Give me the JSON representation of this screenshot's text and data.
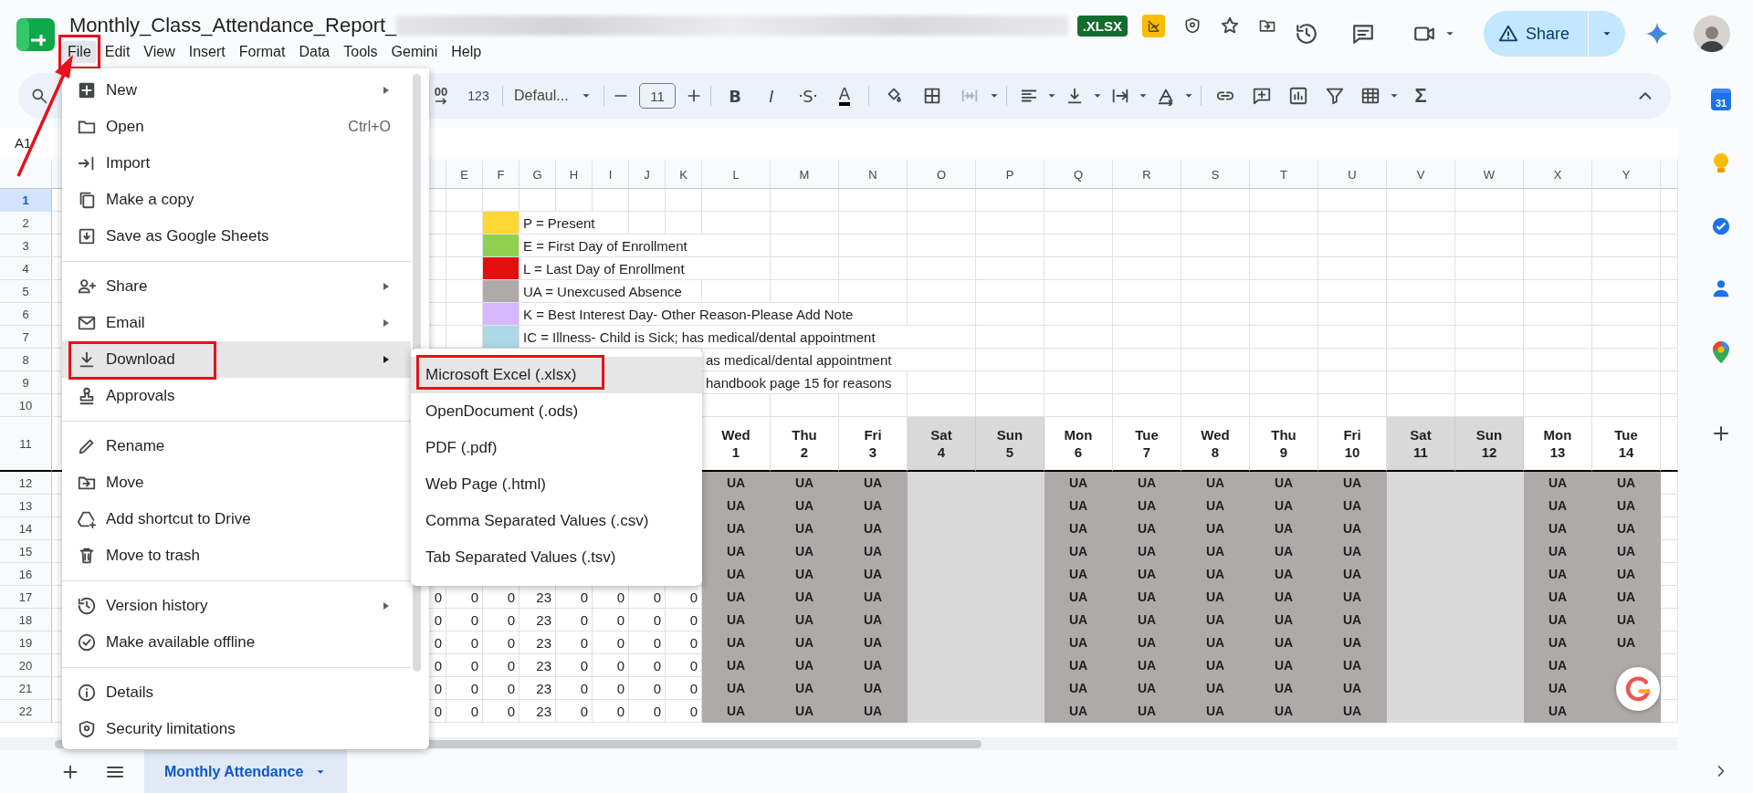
{
  "document": {
    "title": "Monthly_Class_Attendance_Report_",
    "format_badge": ".XLSX"
  },
  "menu_bar": [
    {
      "label": "File",
      "selected": true,
      "annotated": true
    },
    {
      "label": "Edit",
      "selected": false,
      "annotated": false
    },
    {
      "label": "View",
      "selected": false,
      "annotated": false
    },
    {
      "label": "Insert",
      "selected": false,
      "annotated": false
    },
    {
      "label": "Format",
      "selected": false,
      "annotated": false
    },
    {
      "label": "Data",
      "selected": false,
      "annotated": false
    },
    {
      "label": "Tools",
      "selected": false,
      "annotated": false
    },
    {
      "label": "Gemini",
      "selected": false,
      "annotated": false
    },
    {
      "label": "Help",
      "selected": false,
      "annotated": false
    }
  ],
  "share_button": {
    "label": "Share"
  },
  "toolbar": {
    "increase_decimal": "00",
    "number_format": "123",
    "font": "Defaul...",
    "font_size": "11",
    "functions": "Σ",
    "text_styles": [
      {
        "label": "B",
        "kind": "bold"
      },
      {
        "label": "I",
        "kind": "italic"
      },
      {
        "label": "S",
        "kind": "strike"
      },
      {
        "label": "A",
        "kind": "color"
      }
    ]
  },
  "name_box": "A1",
  "sheet": {
    "columns": [
      "E",
      "F",
      "G",
      "H",
      "I",
      "J",
      "K",
      "L",
      "M",
      "N",
      "O",
      "P",
      "Q",
      "R",
      "S",
      "T",
      "U",
      "V",
      "W",
      "X",
      "Y"
    ],
    "rows": [
      {
        "number": "1",
        "selected": true,
        "kind": "blank"
      },
      {
        "number": "2",
        "selected": false,
        "kind": "swatch",
        "color": "#fdd835",
        "text": "P = Present"
      },
      {
        "number": "3",
        "selected": false,
        "kind": "swatch",
        "color": "#8fd14f",
        "text": "E = First Day of Enrollment"
      },
      {
        "number": "4",
        "selected": false,
        "kind": "swatch",
        "color": "#e50e0e",
        "text": "L = Last Day of Enrollment"
      },
      {
        "number": "5",
        "selected": false,
        "kind": "swatch",
        "color": "#aeaaaa",
        "text": "UA = Unexcused Absence"
      },
      {
        "number": "6",
        "selected": false,
        "kind": "swatch",
        "color": "#d5b8ff",
        "text": "K = Best Interest Day- Other Reason-Please Add Note"
      },
      {
        "number": "7",
        "selected": false,
        "kind": "swatch",
        "color": "#add8e6",
        "text": "IC = Illness- Child is Sick; has medical/dental appointment"
      },
      {
        "number": "8",
        "selected": false,
        "kind": "fragment",
        "text": "as medical/dental appointment"
      },
      {
        "number": "9",
        "selected": false,
        "kind": "fragment",
        "text": "handbook page 15 for reasons"
      },
      {
        "number": "10",
        "selected": false,
        "kind": "blank"
      },
      {
        "number": "11",
        "selected": false,
        "kind": "days",
        "days": [
          {
            "day": "Wed",
            "date": "1",
            "weekend": false
          },
          {
            "day": "Thu",
            "date": "2",
            "weekend": false
          },
          {
            "day": "Fri",
            "date": "3",
            "weekend": false
          },
          {
            "day": "Sat",
            "date": "4",
            "weekend": true
          },
          {
            "day": "Sun",
            "date": "5",
            "weekend": true
          },
          {
            "day": "Mon",
            "date": "6",
            "weekend": false
          },
          {
            "day": "Tue",
            "date": "7",
            "weekend": false
          },
          {
            "day": "Wed",
            "date": "8",
            "weekend": false
          },
          {
            "day": "Thu",
            "date": "9",
            "weekend": false
          },
          {
            "day": "Fri",
            "date": "10",
            "weekend": false
          },
          {
            "day": "Sat",
            "date": "11",
            "weekend": true
          },
          {
            "day": "Sun",
            "date": "12",
            "weekend": true
          },
          {
            "day": "Mon",
            "date": "13",
            "weekend": false
          },
          {
            "day": "Tue",
            "date": "14",
            "weekend": false
          }
        ]
      },
      {
        "number": "12",
        "selected": false,
        "kind": "attendance",
        "marks": [
          "UA",
          "UA",
          "UA",
          "UA",
          "UA",
          "UA",
          "UA",
          "UA",
          "UA",
          "UA"
        ]
      },
      {
        "number": "13",
        "selected": false,
        "kind": "attendance",
        "marks": [
          "UA",
          "UA",
          "UA",
          "UA",
          "UA",
          "UA",
          "UA",
          "UA",
          "UA",
          "UA"
        ]
      },
      {
        "number": "14",
        "selected": false,
        "kind": "attendance",
        "marks": [
          "UA",
          "UA",
          "UA",
          "UA",
          "UA",
          "UA",
          "UA",
          "UA",
          "UA",
          "UA"
        ]
      },
      {
        "number": "15",
        "selected": false,
        "kind": "attendance",
        "marks": [
          "UA",
          "UA",
          "UA",
          "UA",
          "UA",
          "UA",
          "UA",
          "UA",
          "UA",
          "UA"
        ]
      },
      {
        "number": "16",
        "selected": false,
        "kind": "attendance",
        "marks": [
          "UA",
          "UA",
          "UA",
          "UA",
          "UA",
          "UA",
          "UA",
          "UA",
          "UA",
          "UA"
        ]
      },
      {
        "number": "17",
        "selected": false,
        "kind": "attendance",
        "counts": [
          "0",
          "0",
          "0",
          "23",
          "0",
          "0",
          "0",
          "0"
        ],
        "marks": [
          "UA",
          "UA",
          "UA",
          "UA",
          "UA",
          "UA",
          "UA",
          "UA",
          "UA",
          "UA"
        ]
      },
      {
        "number": "18",
        "selected": false,
        "kind": "attendance",
        "counts": [
          "0",
          "0",
          "0",
          "23",
          "0",
          "0",
          "0",
          "0"
        ],
        "marks": [
          "UA",
          "UA",
          "UA",
          "UA",
          "UA",
          "UA",
          "UA",
          "UA",
          "UA",
          "UA"
        ]
      },
      {
        "number": "19",
        "selected": false,
        "kind": "attendance",
        "counts": [
          "0",
          "0",
          "0",
          "23",
          "0",
          "0",
          "0",
          "0"
        ],
        "marks": [
          "UA",
          "UA",
          "UA",
          "UA",
          "UA",
          "UA",
          "UA",
          "UA",
          "UA",
          "UA"
        ]
      },
      {
        "number": "20",
        "selected": false,
        "kind": "attendance",
        "counts": [
          "0",
          "0",
          "0",
          "23",
          "0",
          "0",
          "0",
          "0"
        ],
        "marks": [
          "UA",
          "UA",
          "UA",
          "UA",
          "UA",
          "UA",
          "UA",
          "UA",
          "UA"
        ]
      },
      {
        "number": "21",
        "selected": false,
        "kind": "attendance",
        "counts": [
          "0",
          "0",
          "0",
          "23",
          "0",
          "0",
          "0",
          "0"
        ],
        "marks": [
          "UA",
          "UA",
          "UA",
          "UA",
          "UA",
          "UA",
          "UA",
          "UA",
          "UA"
        ]
      },
      {
        "number": "22",
        "selected": false,
        "kind": "attendance",
        "counts": [
          "0",
          "0",
          "0",
          "23",
          "0",
          "0",
          "0",
          "0"
        ],
        "marks": [
          "UA",
          "UA",
          "UA",
          "UA",
          "UA",
          "UA",
          "UA",
          "UA",
          "UA"
        ]
      }
    ]
  },
  "sheet_tabs": [
    {
      "label": "Monthly Attendance",
      "selected": true
    }
  ],
  "sidebar": {
    "calendar_date": "31"
  },
  "file_menu": {
    "sections": [
      [
        {
          "label": "New",
          "submenu": true,
          "selected": false,
          "annotated": false
        },
        {
          "label": "Open",
          "shortcut": "Ctrl+O",
          "submenu": false,
          "selected": false,
          "annotated": false
        },
        {
          "label": "Import",
          "submenu": false,
          "selected": false,
          "annotated": false
        },
        {
          "label": "Make a copy",
          "submenu": false,
          "selected": false,
          "annotated": false
        },
        {
          "label": "Save as Google Sheets",
          "submenu": false,
          "selected": false,
          "annotated": false
        }
      ],
      [
        {
          "label": "Share",
          "submenu": true,
          "selected": false,
          "annotated": false
        },
        {
          "label": "Email",
          "submenu": true,
          "selected": false,
          "annotated": false
        },
        {
          "label": "Download",
          "submenu": true,
          "selected": true,
          "annotated": true
        },
        {
          "label": "Approvals",
          "submenu": false,
          "selected": false,
          "annotated": false
        }
      ],
      [
        {
          "label": "Rename",
          "submenu": false,
          "selected": false,
          "annotated": false
        },
        {
          "label": "Move",
          "submenu": false,
          "selected": false,
          "annotated": false
        },
        {
          "label": "Add shortcut to Drive",
          "submenu": false,
          "selected": false,
          "annotated": false
        },
        {
          "label": "Move to trash",
          "submenu": false,
          "selected": false,
          "annotated": false
        }
      ],
      [
        {
          "label": "Version history",
          "submenu": true,
          "selected": false,
          "annotated": false
        },
        {
          "label": "Make available offline",
          "submenu": false,
          "selected": false,
          "annotated": false
        }
      ],
      [
        {
          "label": "Details",
          "submenu": false,
          "selected": false,
          "annotated": false
        },
        {
          "label": "Security limitations",
          "submenu": false,
          "selected": false,
          "annotated": false
        }
      ]
    ]
  },
  "download_submenu": [
    {
      "label": "Microsoft Excel (.xlsx)",
      "selected": true,
      "annotated": true
    },
    {
      "label": "OpenDocument (.ods)",
      "selected": false,
      "annotated": false
    },
    {
      "label": "PDF (.pdf)",
      "selected": false,
      "annotated": false
    },
    {
      "label": "Web Page (.html)",
      "selected": false,
      "annotated": false
    },
    {
      "label": "Comma Separated Values (.csv)",
      "selected": false,
      "annotated": false
    },
    {
      "label": "Tab Separated Values (.tsv)",
      "selected": false,
      "annotated": false
    }
  ],
  "annotation_arrow": true
}
